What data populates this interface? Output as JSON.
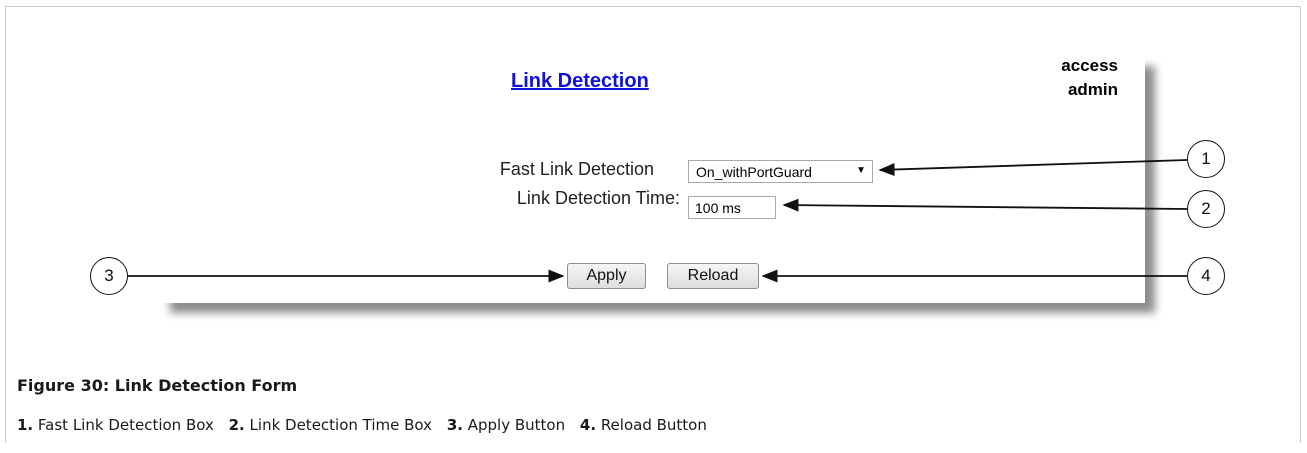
{
  "form": {
    "title": "Link Detection",
    "access_label": "access",
    "access_user": "admin",
    "fast_link_detection": {
      "label": "Fast Link Detection",
      "value": "On_withPortGuard"
    },
    "link_detection_time": {
      "label": "Link Detection Time:",
      "value": "100 ms"
    },
    "apply_label": "Apply",
    "reload_label": "Reload"
  },
  "callouts": [
    "1",
    "2",
    "3",
    "4"
  ],
  "figure": {
    "title": "Figure 30: Link Detection Form",
    "legend": [
      {
        "num": "1.",
        "text": "Fast Link Detection Box"
      },
      {
        "num": "2.",
        "text": "Link Detection Time Box"
      },
      {
        "num": "3.",
        "text": "Apply Button"
      },
      {
        "num": "4.",
        "text": "Reload Button"
      }
    ]
  },
  "colors": {
    "title_link": "#1010d8",
    "button_border": "#8e8e8e"
  }
}
